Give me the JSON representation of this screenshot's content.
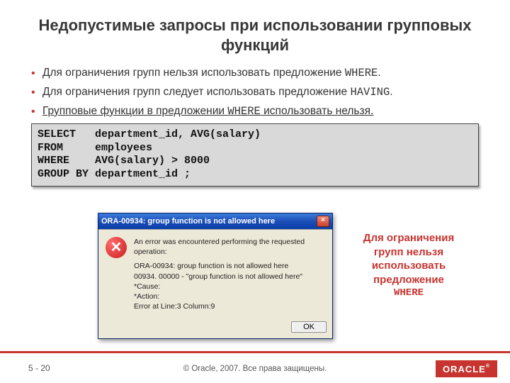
{
  "title": "Недопустимые запросы при использовании групповых функций",
  "bullets": {
    "b1a": "Для ограничения групп нельзя использовать предложение ",
    "b1code": "WHERE",
    "b1b": ".",
    "b2a": "Для ограничения групп следует использовать предложение ",
    "b2code": "HAVING",
    "b2b": ".",
    "b3a": "Групповые функции в предложении ",
    "b3code": "WHERE",
    "b3b": " использовать нельзя.",
    "underline_full": "Групповые функции в предложении WHERE использовать нельзя."
  },
  "code": "SELECT   department_id, AVG(salary)\nFROM     employees\nWHERE    AVG(salary) > 8000\nGROUP BY department_id ;",
  "dialog": {
    "title": "ORA-00934: group function is not allowed here",
    "close": "×",
    "intro": "An error was encountered performing the requested operation:",
    "line1": "ORA-00934: group function is not allowed here",
    "line2": "00934. 00000 -  \"group function is not allowed here\"",
    "line3": "*Cause:",
    "line4": "*Action:",
    "line5": "Error at Line:3 Column:9",
    "ok": "OK"
  },
  "callout": {
    "l1": "Для ограничения",
    "l2": "групп нельзя",
    "l3": "использовать",
    "l4": "предложение",
    "l5": "WHERE"
  },
  "footer": {
    "page": "5 - 20",
    "copyright": "© Oracle, 2007. Все права защищены.",
    "logo": "ORACLE"
  }
}
